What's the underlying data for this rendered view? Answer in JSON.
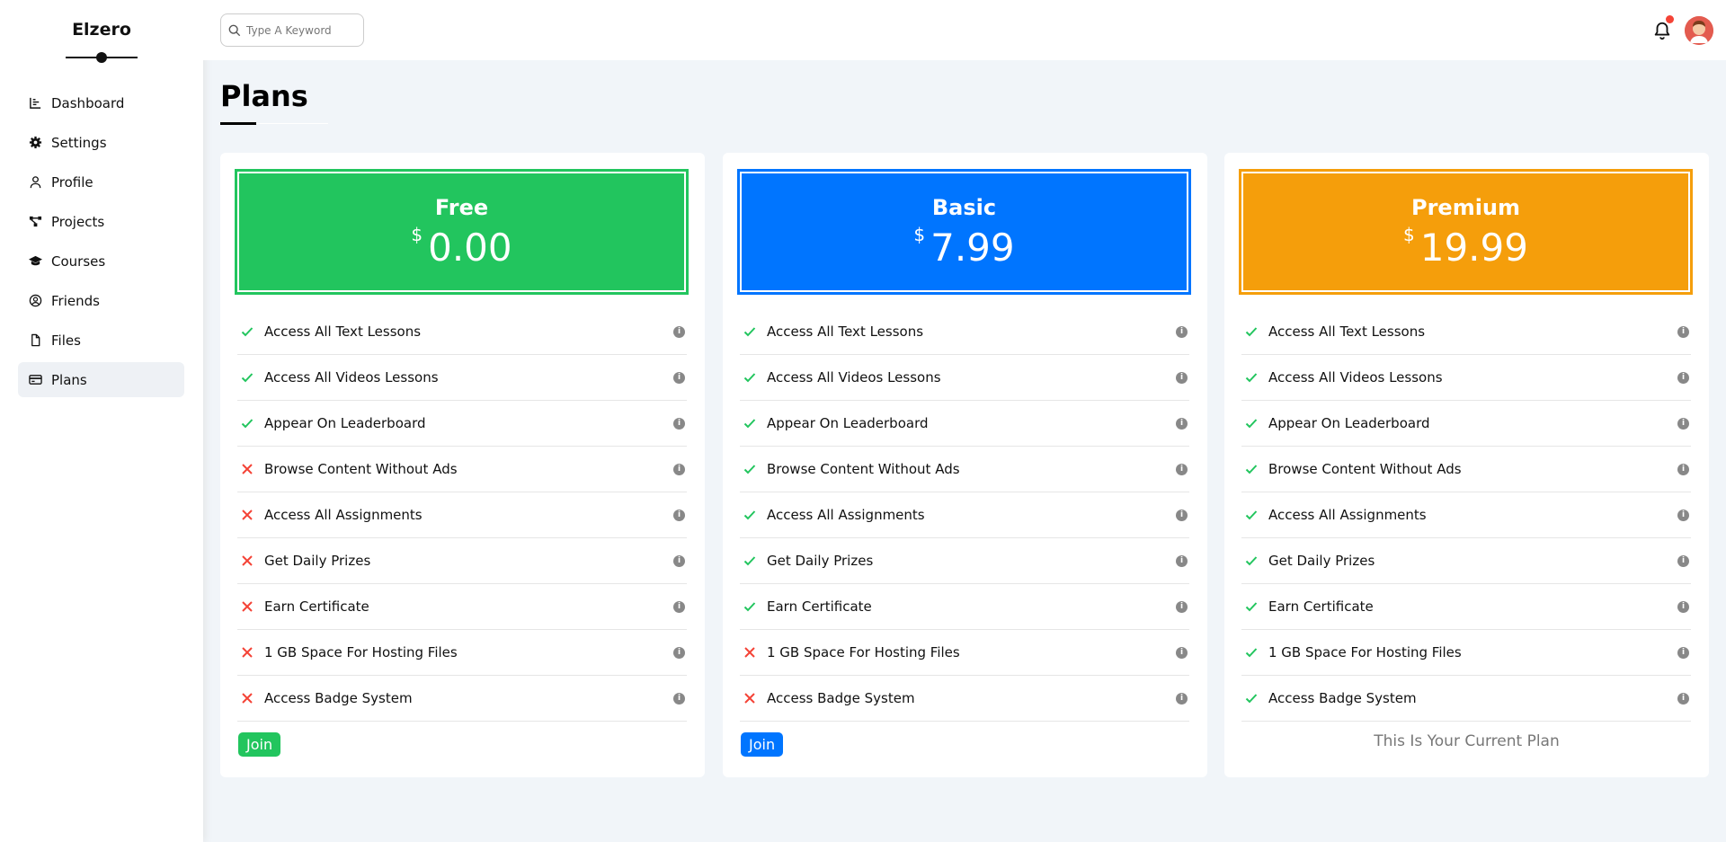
{
  "sidebar": {
    "brand": "Elzero",
    "items": [
      {
        "label": "Dashboard",
        "icon": "chart-icon"
      },
      {
        "label": "Settings",
        "icon": "gear-icon"
      },
      {
        "label": "Profile",
        "icon": "user-icon"
      },
      {
        "label": "Projects",
        "icon": "diagram-icon"
      },
      {
        "label": "Courses",
        "icon": "graduation-cap-icon"
      },
      {
        "label": "Friends",
        "icon": "user-circle-icon"
      },
      {
        "label": "Files",
        "icon": "file-icon"
      },
      {
        "label": "Plans",
        "icon": "credit-card-icon"
      }
    ],
    "active": "Plans"
  },
  "header": {
    "search_placeholder": "Type A Keyword"
  },
  "page": {
    "title": "Plans"
  },
  "plans": [
    {
      "name": "Free",
      "currency": "$",
      "price": "0.00",
      "color": "#22c55e",
      "features": [
        {
          "text": "Access All Text Lessons",
          "included": true
        },
        {
          "text": "Access All Videos Lessons",
          "included": true
        },
        {
          "text": "Appear On Leaderboard",
          "included": true
        },
        {
          "text": "Browse Content Without Ads",
          "included": false
        },
        {
          "text": "Access All Assignments",
          "included": false
        },
        {
          "text": "Get Daily Prizes",
          "included": false
        },
        {
          "text": "Earn Certificate",
          "included": false
        },
        {
          "text": "1 GB Space For Hosting Files",
          "included": false
        },
        {
          "text": "Access Badge System",
          "included": false
        }
      ],
      "action": "Join"
    },
    {
      "name": "Basic",
      "currency": "$",
      "price": "7.99",
      "color": "#0075ff",
      "features": [
        {
          "text": "Access All Text Lessons",
          "included": true
        },
        {
          "text": "Access All Videos Lessons",
          "included": true
        },
        {
          "text": "Appear On Leaderboard",
          "included": true
        },
        {
          "text": "Browse Content Without Ads",
          "included": true
        },
        {
          "text": "Access All Assignments",
          "included": true
        },
        {
          "text": "Get Daily Prizes",
          "included": true
        },
        {
          "text": "Earn Certificate",
          "included": true
        },
        {
          "text": "1 GB Space For Hosting Files",
          "included": false
        },
        {
          "text": "Access Badge System",
          "included": false
        }
      ],
      "action": "Join"
    },
    {
      "name": "Premium",
      "currency": "$",
      "price": "19.99",
      "color": "#f59e0b",
      "features": [
        {
          "text": "Access All Text Lessons",
          "included": true
        },
        {
          "text": "Access All Videos Lessons",
          "included": true
        },
        {
          "text": "Appear On Leaderboard",
          "included": true
        },
        {
          "text": "Browse Content Without Ads",
          "included": true
        },
        {
          "text": "Access All Assignments",
          "included": true
        },
        {
          "text": "Get Daily Prizes",
          "included": true
        },
        {
          "text": "Earn Certificate",
          "included": true
        },
        {
          "text": "1 GB Space For Hosting Files",
          "included": true
        },
        {
          "text": "Access Badge System",
          "included": true
        }
      ],
      "current_text": "This Is Your Current Plan"
    }
  ],
  "colors": {
    "check": "#22c55e",
    "cross": "#f44336",
    "info": "#888888"
  }
}
